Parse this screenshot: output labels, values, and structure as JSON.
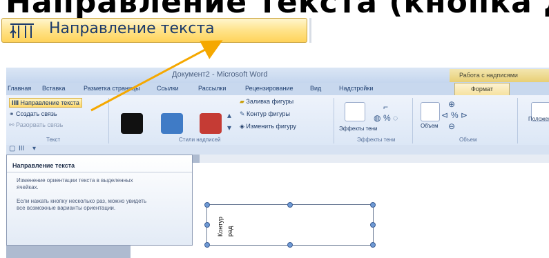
{
  "heading": {
    "text": "Направление текста (кнопка для ра"
  },
  "zoom_button": {
    "label": "Направление текста",
    "icon": "text-direction-icon"
  },
  "window": {
    "title": "Документ2 - Microsoft Word",
    "context_title": "Работа с надписями"
  },
  "tabs": [
    {
      "label": "Главная"
    },
    {
      "label": "Вставка"
    },
    {
      "label": "Разметка страницы"
    },
    {
      "label": "Ссылки"
    },
    {
      "label": "Рассылки"
    },
    {
      "label": "Рецензирование"
    },
    {
      "label": "Вид"
    },
    {
      "label": "Надстройки"
    },
    {
      "label": "Формат"
    }
  ],
  "ribbon": {
    "text_group": {
      "label": "Текст",
      "text_direction": "Направление текста",
      "create_link": "Создать связь",
      "break_link": "Разорвать связь"
    },
    "styles_group": {
      "label": "Стили надписей",
      "fill": "Заливка фигуры",
      "outline": "Контур фигуры",
      "change_shape": "Изменить фигуру",
      "swatch_colors": [
        "#111111",
        "#3f7bc6",
        "#c53b34"
      ]
    },
    "shadow_group": {
      "label": "Эффекты тени",
      "shadow_effects": "Эффекты тени"
    },
    "volume_group": {
      "label": "Объем",
      "volume": "Объем"
    },
    "position": "Положение"
  },
  "tooltip": {
    "title": "Направление текста",
    "line1": "Изменение ориентации текста в выделенных ячейках.",
    "line2": "Если нажать кнопку несколько раз, можно увидеть все возможные варианты ориентации."
  },
  "textbox": {
    "line1": "Контур",
    "line2": "рад"
  },
  "colors": {
    "arrow": "#f5a800",
    "ribbon_tab": "#c8d8ee"
  }
}
